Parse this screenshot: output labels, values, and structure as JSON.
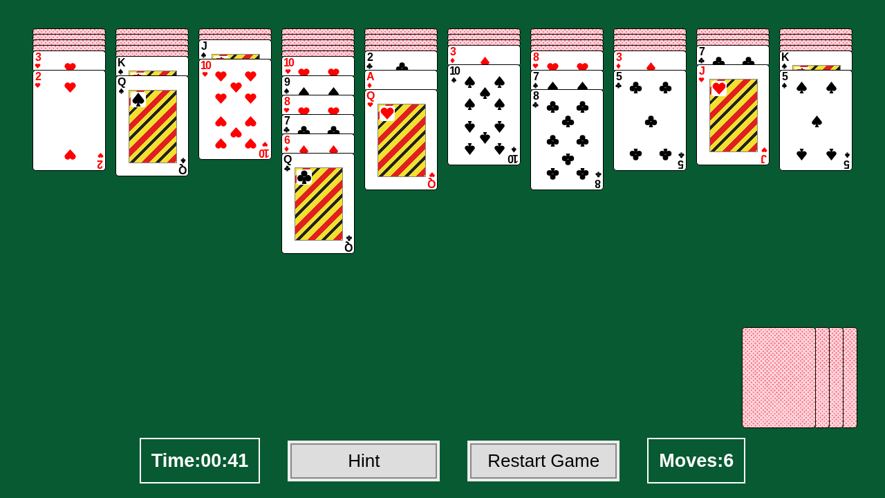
{
  "tableau": [
    {
      "cards": [
        {
          "face_up": false
        },
        {
          "face_up": false
        },
        {
          "face_up": false
        },
        {
          "face_up": false
        },
        {
          "face_up": true,
          "rank": "3",
          "kind": "hearts"
        },
        {
          "face_up": true,
          "rank": "2",
          "kind": "hearts",
          "corner_rank": "2"
        }
      ]
    },
    {
      "cards": [
        {
          "face_up": false
        },
        {
          "face_up": false
        },
        {
          "face_up": false
        },
        {
          "face_up": false
        },
        {
          "face_up": false
        },
        {
          "face_up": true,
          "rank": "K",
          "kind": "spades"
        },
        {
          "face_up": true,
          "rank": "Q",
          "kind": "spades",
          "corner_rank": "Q"
        }
      ]
    },
    {
      "cards": [
        {
          "face_up": false
        },
        {
          "face_up": false
        },
        {
          "face_up": true,
          "rank": "J",
          "kind": "spades"
        },
        {
          "face_up": true,
          "rank": "10",
          "kind": "hearts",
          "corner_rank": "10"
        }
      ]
    },
    {
      "cards": [
        {
          "face_up": false
        },
        {
          "face_up": false
        },
        {
          "face_up": false
        },
        {
          "face_up": false
        },
        {
          "face_up": false
        },
        {
          "face_up": true,
          "rank": "10",
          "kind": "hearts"
        },
        {
          "face_up": true,
          "rank": "9",
          "kind": "spades"
        },
        {
          "face_up": true,
          "rank": "8",
          "kind": "hearts"
        },
        {
          "face_up": true,
          "rank": "7",
          "kind": "clubs"
        },
        {
          "face_up": true,
          "rank": "6",
          "kind": "diamonds"
        },
        {
          "face_up": true,
          "rank": "Q",
          "kind": "clubs",
          "corner_rank": "Q"
        }
      ]
    },
    {
      "cards": [
        {
          "face_up": false
        },
        {
          "face_up": false
        },
        {
          "face_up": false
        },
        {
          "face_up": false
        },
        {
          "face_up": true,
          "rank": "2",
          "kind": "clubs"
        },
        {
          "face_up": true,
          "rank": "A",
          "kind": "diamonds"
        },
        {
          "face_up": true,
          "rank": "Q",
          "kind": "hearts",
          "corner_rank": "Q"
        }
      ]
    },
    {
      "cards": [
        {
          "face_up": false
        },
        {
          "face_up": false
        },
        {
          "face_up": false
        },
        {
          "face_up": true,
          "rank": "3",
          "kind": "diamonds"
        },
        {
          "face_up": true,
          "rank": "10",
          "kind": "spades",
          "corner_rank": "10"
        }
      ]
    },
    {
      "cards": [
        {
          "face_up": false
        },
        {
          "face_up": false
        },
        {
          "face_up": false
        },
        {
          "face_up": false
        },
        {
          "face_up": true,
          "rank": "8",
          "kind": "hearts"
        },
        {
          "face_up": true,
          "rank": "7",
          "kind": "spades"
        },
        {
          "face_up": true,
          "rank": "8",
          "kind": "clubs",
          "corner_rank": "8"
        }
      ]
    },
    {
      "cards": [
        {
          "face_up": false
        },
        {
          "face_up": false
        },
        {
          "face_up": false
        },
        {
          "face_up": false
        },
        {
          "face_up": true,
          "rank": "3",
          "kind": "diamonds"
        },
        {
          "face_up": true,
          "rank": "5",
          "kind": "clubs",
          "corner_rank": "5"
        }
      ]
    },
    {
      "cards": [
        {
          "face_up": false
        },
        {
          "face_up": false
        },
        {
          "face_up": false
        },
        {
          "face_up": true,
          "rank": "7",
          "kind": "clubs"
        },
        {
          "face_up": true,
          "rank": "J",
          "kind": "hearts",
          "corner_rank": "J"
        }
      ]
    },
    {
      "cards": [
        {
          "face_up": false
        },
        {
          "face_up": false
        },
        {
          "face_up": false
        },
        {
          "face_up": false
        },
        {
          "face_up": true,
          "rank": "K",
          "kind": "spades"
        },
        {
          "face_up": true,
          "rank": "5",
          "kind": "spades",
          "corner_rank": "5"
        }
      ]
    }
  ],
  "stock": [
    {
      "face_up": false
    },
    {
      "face_up": false
    },
    {
      "face_up": false
    },
    {
      "face_up": false
    }
  ],
  "footer": [
    {
      "kind": "display",
      "label": "Time:00:41"
    },
    {
      "kind": "button",
      "label": "Hint"
    },
    {
      "kind": "button",
      "label": "Restart Game"
    },
    {
      "kind": "display",
      "label": "Moves:6"
    }
  ]
}
